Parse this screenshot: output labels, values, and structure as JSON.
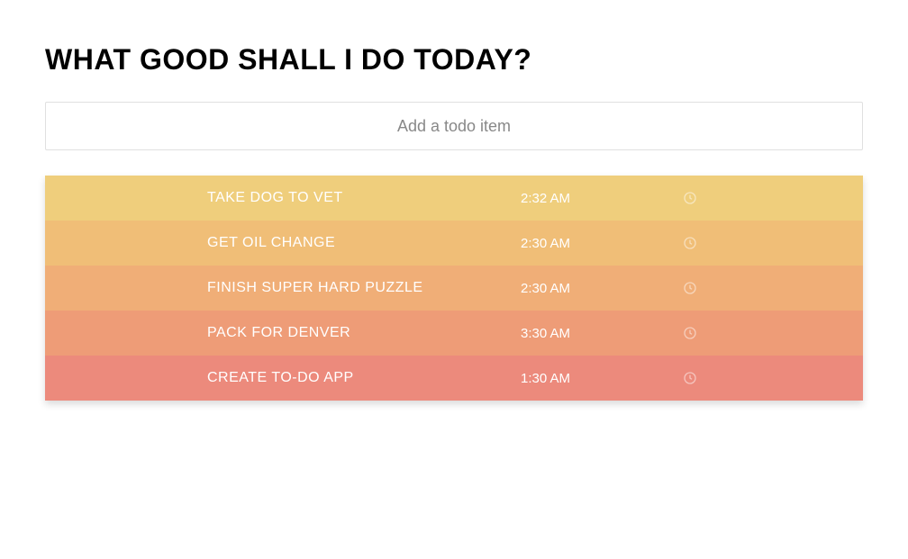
{
  "header": {
    "title": "WHAT GOOD SHALL I DO TODAY?"
  },
  "input": {
    "placeholder": "Add a todo item",
    "value": ""
  },
  "todos": [
    {
      "text": "TAKE DOG TO VET",
      "time": "2:32 AM",
      "bg": "#efce7c"
    },
    {
      "text": "GET OIL CHANGE",
      "time": "2:30 AM",
      "bg": "#f0be77"
    },
    {
      "text": "FINISH SUPER HARD PUZZLE",
      "time": "2:30 AM",
      "bg": "#f0ae77"
    },
    {
      "text": "PACK FOR DENVER",
      "time": "3:30 AM",
      "bg": "#ee9c77"
    },
    {
      "text": "CREATE TO-DO APP",
      "time": "1:30 AM",
      "bg": "#ec8a7c"
    }
  ]
}
